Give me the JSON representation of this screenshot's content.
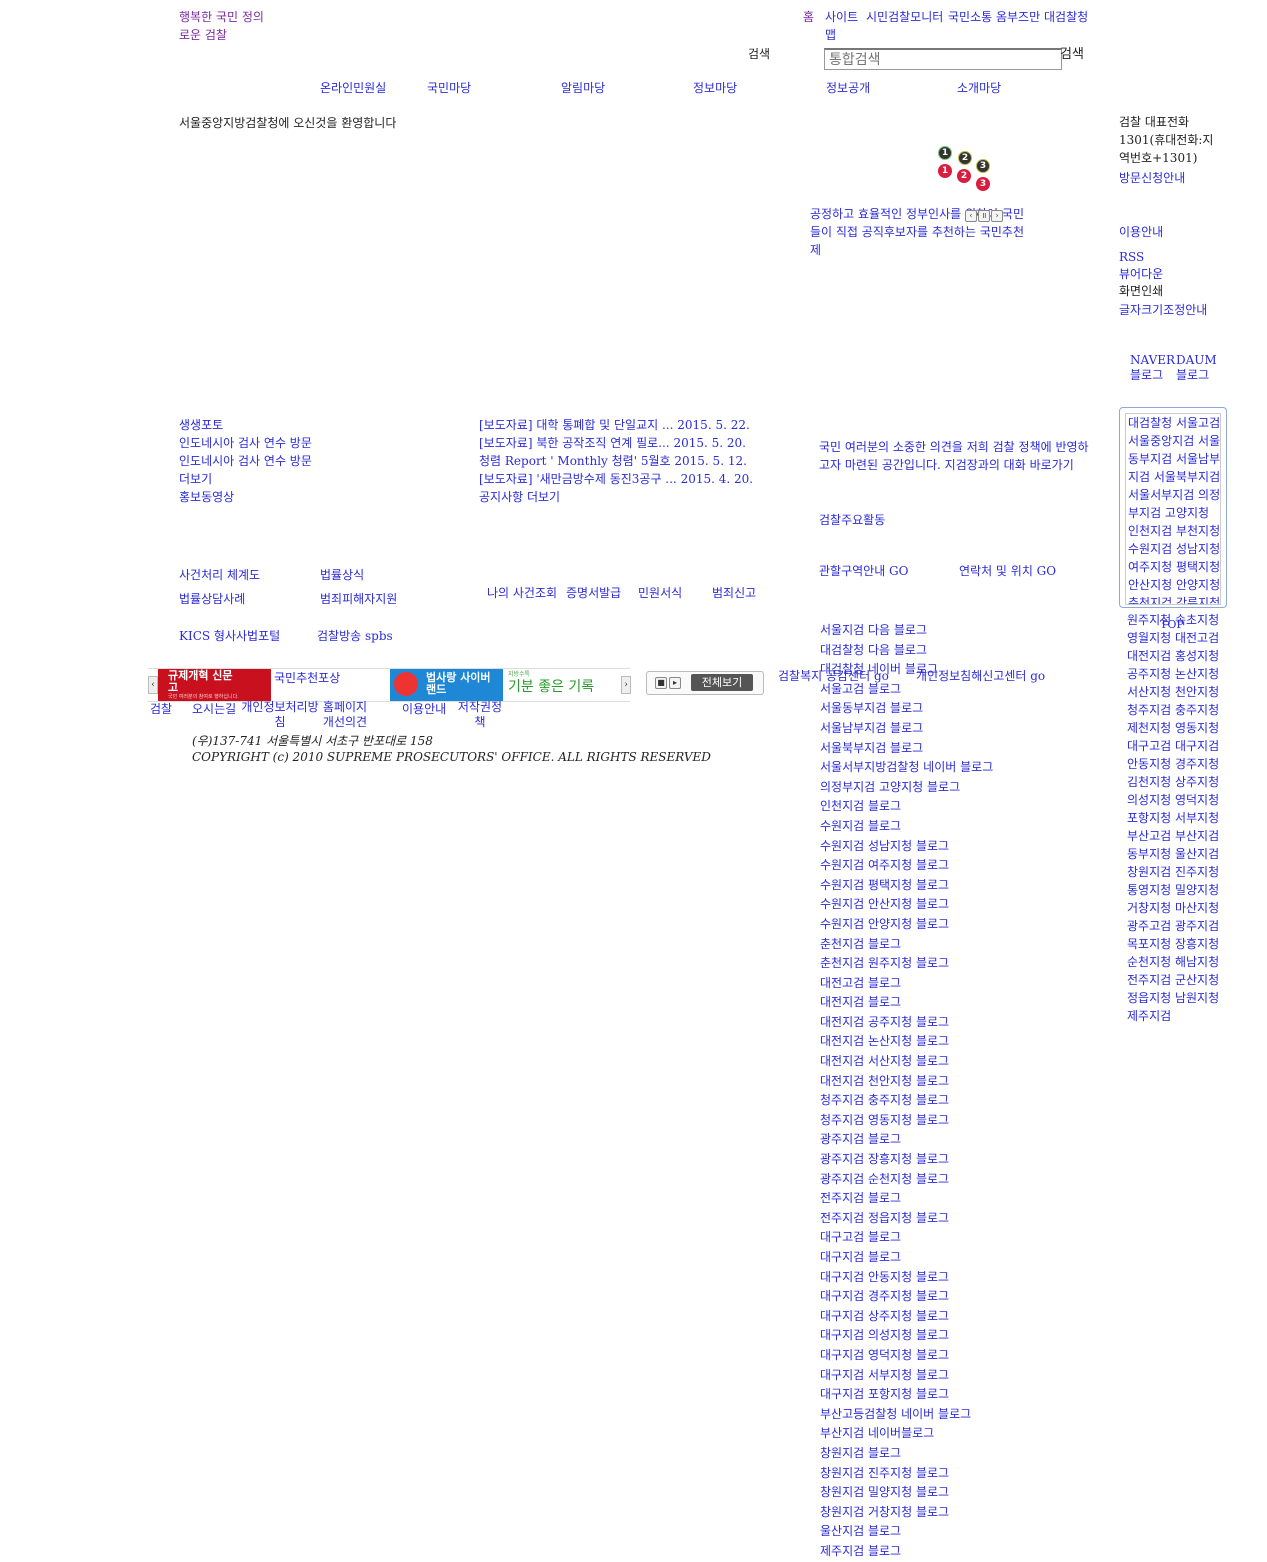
{
  "header": {
    "slogan": "행복한 국민 정의로운 검찰",
    "top_links": [
      "홈",
      "사이트맵",
      "시민검찰모니터",
      "국민소통 옴부즈만",
      "대검찰청"
    ],
    "search_label": "검색",
    "search_placeholder": "통합검색",
    "search_button": "검색"
  },
  "gnb": [
    "온라인민원실",
    "국민마당",
    "알림마당",
    "정보마당",
    "정보공개",
    "소개마당"
  ],
  "welcome": "서울중앙지방검찰청에 오신것을 환영합니다",
  "right_info": {
    "phone_title": "검찰 대표전화",
    "phone_text": "1301(휴대전화:지역번호+1301)",
    "visit_link": "방문신청안내",
    "usage_link": "이용안내",
    "rss": "RSS",
    "viewer": "뷰어다운",
    "print": "화면인쇄",
    "font_size": "글자크기조정안내",
    "naver_blog": "NAVER 블로그",
    "daum_blog": "DAUM 블로그"
  },
  "rolling": {
    "nums_top": [
      "1",
      "2",
      "3"
    ],
    "nums_bottom": [
      "1",
      "2",
      "3"
    ],
    "text": "공정하고 효율적인 정부인사를 위하여 국민들이 직접 공직후보자를 추천하는 국민추천제"
  },
  "photo_news": [
    "생생포토",
    "인도네시아 검사 연수 방문",
    "인도네시아 검사 연수 방문",
    "더보기",
    "홍보동영상"
  ],
  "notices": [
    {
      "title": "[보도자료] 대학 통폐합 및 단일교지 ...",
      "date": "2015. 5. 22."
    },
    {
      "title": "[보도자료] 북한 공작조직 연계 필로...",
      "date": "2015. 5. 20."
    },
    {
      "title": "청렴 Report ' Monthly 청렴' 5월호",
      "date": "2015. 5. 12."
    },
    {
      "title": "[보도자료] '새만금방수제 동진3공구 ...",
      "date": "2015. 4. 20."
    }
  ],
  "notice_more": "공지사항 더보기",
  "dialogue_text": "국민 여러분의 소중한 의견을 저희 검찰 정책에 반영하고자 마련된 공간입니다. 지검장과의 대화 바로가기",
  "main_activities": "검찰주요활동",
  "region_link": "관할구역안내 GO",
  "contact_link": "연락처 및 위치 GO",
  "quick_links_left": [
    "사건처리 체계도",
    "법률상식",
    "법률상담사례",
    "범죄피해자지원"
  ],
  "quick_links_mid": [
    "나의 사건조회",
    "증명서발급",
    "민원서식",
    "범죄신고"
  ],
  "quick_links_bottom": [
    "KICS 형사사법포털",
    "검찰방송 spbs"
  ],
  "banner": {
    "regulation_title": "규제개혁 신문고",
    "regulation_sub": "국민 여러분의 참여로 행하십니다.",
    "citizen_award": "국민추천포상",
    "cyberland": "법사랑 사이버랜드",
    "mood_top": "지방수특",
    "mood_main": "기분 좋은 기록",
    "view_all": "전체보기",
    "welfare": "검찰복지 공감센터 go",
    "privacy_report": "개인정보침해신고센터 go"
  },
  "blogs": [
    "서울지검 다음 블로그",
    "대검찰청 다음 블로그",
    "대검찰청 네이버 블로그",
    "서울고검 블로그",
    "서울동부지검 블로그",
    "서울남부지검 블로그",
    "서울북부지검 블로그",
    "서울서부지방검찰청 네이버 블로그",
    "의정부지검 고양지청 블로그",
    "인천지검 블로그",
    "수원지검 블로그",
    "수원지검 성남지청 블로그",
    "수원지검 여주지청 블로그",
    "수원지검 평택지청 블로그",
    "수원지검 안산지청 블로그",
    "수원지검 안양지청 블로그",
    "춘천지검 블로그",
    "춘천지검 원주지청 블로그",
    "대전고검 블로그",
    "대전지검 블로그",
    "대전지검 공주지청 블로그",
    "대전지검 논산지청 블로그",
    "대전지검 서산지청 블로그",
    "대전지검 천안지청 블로그",
    "청주지검 충주지청 블로그",
    "청주지검 영동지청 블로그",
    "광주지검 블로그",
    "광주지검 장흥지청 블로그",
    "광주지검 순천지청 블로그",
    "전주지검 블로그",
    "전주지검 정읍지청 블로그",
    "대구고검 블로그",
    "대구지검 블로그",
    "대구지검 안동지청 블로그",
    "대구지검 경주지청 블로그",
    "대구지검 상주지청 블로그",
    "대구지검 의성지청 블로그",
    "대구지검 영덕지청 블로그",
    "대구지검 서부지청 블로그",
    "대구지검 포항지청 블로그",
    "부산고등검찰청 네이버 블로그",
    "부산지검 네이버블로그",
    "창원지검 블로그",
    "창원지검 진주지청 블로그",
    "창원지검 밀양지청 블로그",
    "창원지검 거창지청 블로그",
    "울산지검 블로그",
    "제주지검 블로그"
  ],
  "offices_inner": [
    "대검찰청 서울고검",
    "서울중앙지검 서울",
    "동부지검 서울남부",
    "지검 서울북부지검",
    "서울서부지검 의정",
    "부지검 고양지청",
    "인천지검 부천지청",
    "수원지검 성남지청",
    "여주지청 평택지청",
    "안산지청 안양지청",
    "춘천지검 강릉지청"
  ],
  "offices_outer": [
    "원주지청 속초지청",
    "영월지청 대전고검",
    "대전지검 홍성지청",
    "공주지청 논산지청",
    "서산지청 천안지청",
    "청주지검 충주지청",
    "제천지청 영동지청",
    "대구고검 대구지검",
    "안동지청 경주지청",
    "김천지청 상주지청",
    "의성지청 영덕지청",
    "포항지청 서부지청",
    "부산고검 부산지검",
    "동부지청 울산지검",
    "창원지검 진주지청",
    "통영지청 밀양지청",
    "거창지청 마산지청",
    "광주고검 광주지검",
    "목포지청 장흥지청",
    "순천지청 해남지청",
    "전주지검 군산지청",
    "정읍지청 남원지청",
    "제주지검"
  ],
  "top_link": "TOP",
  "footer": {
    "links": [
      "검찰",
      "오시는길",
      "개인정보처리방침",
      "홈페이지 개선의견",
      "이용안내",
      "저작권정책"
    ],
    "address": "(우)137-741 서울특별시 서초구 반포대로 158",
    "copyright": "COPYRIGHT (c) 2010 SUPREME PROSECUTORS' OFFICE. ALL RIGHTS RESERVED"
  }
}
